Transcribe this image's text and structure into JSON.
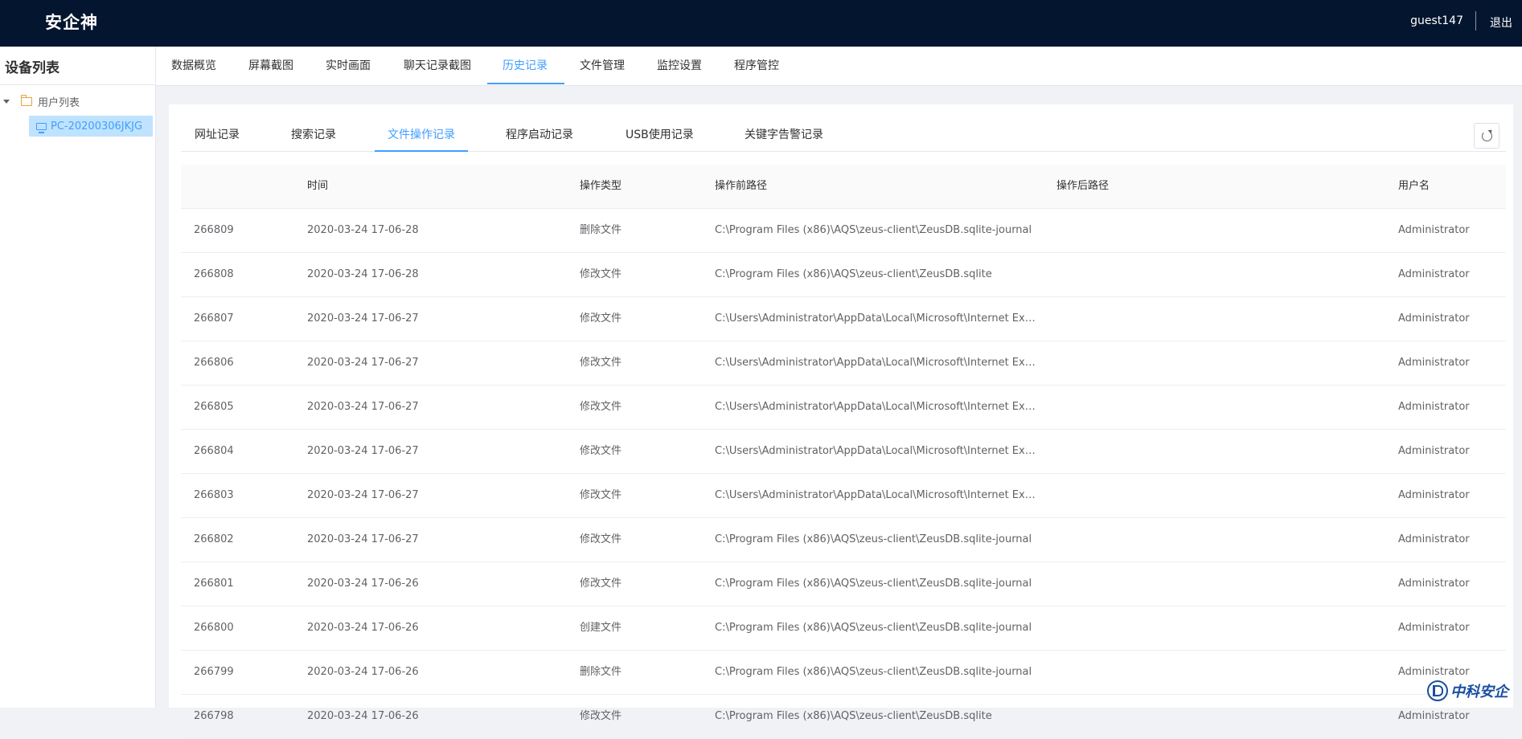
{
  "app": {
    "title": "安企神",
    "username": "guest147",
    "logout_label": "退出"
  },
  "sidebar": {
    "title": "设备列表",
    "tree": {
      "root_label": "用户列表",
      "selected_device": "PC-20200306JKJG"
    }
  },
  "nav": {
    "items": [
      "数据概览",
      "屏幕截图",
      "实时画面",
      "聊天记录截图",
      "历史记录",
      "文件管理",
      "监控设置",
      "程序管控"
    ],
    "active": "历史记录"
  },
  "subtabs": {
    "items": [
      "网址记录",
      "搜索记录",
      "文件操作记录",
      "程序启动记录",
      "USB使用记录",
      "关键字告警记录"
    ],
    "active": "文件操作记录"
  },
  "table": {
    "headers": [
      "",
      "时间",
      "操作类型",
      "操作前路径",
      "操作后路径",
      "用户名"
    ],
    "rows": [
      [
        "266809",
        "2020-03-24 17-06-28",
        "删除文件",
        "C:\\Program Files (x86)\\AQS\\zeus-client\\ZeusDB.sqlite-journal",
        "",
        "Administrator"
      ],
      [
        "266808",
        "2020-03-24 17-06-28",
        "修改文件",
        "C:\\Program Files (x86)\\AQS\\zeus-client\\ZeusDB.sqlite",
        "",
        "Administrator"
      ],
      [
        "266807",
        "2020-03-24 17-06-27",
        "修改文件",
        "C:\\Users\\Administrator\\AppData\\Local\\Microsoft\\Internet Exp...",
        "",
        "Administrator"
      ],
      [
        "266806",
        "2020-03-24 17-06-27",
        "修改文件",
        "C:\\Users\\Administrator\\AppData\\Local\\Microsoft\\Internet Exp...",
        "",
        "Administrator"
      ],
      [
        "266805",
        "2020-03-24 17-06-27",
        "修改文件",
        "C:\\Users\\Administrator\\AppData\\Local\\Microsoft\\Internet Exp...",
        "",
        "Administrator"
      ],
      [
        "266804",
        "2020-03-24 17-06-27",
        "修改文件",
        "C:\\Users\\Administrator\\AppData\\Local\\Microsoft\\Internet Exp...",
        "",
        "Administrator"
      ],
      [
        "266803",
        "2020-03-24 17-06-27",
        "修改文件",
        "C:\\Users\\Administrator\\AppData\\Local\\Microsoft\\Internet Exp...",
        "",
        "Administrator"
      ],
      [
        "266802",
        "2020-03-24 17-06-27",
        "修改文件",
        "C:\\Program Files (x86)\\AQS\\zeus-client\\ZeusDB.sqlite-journal",
        "",
        "Administrator"
      ],
      [
        "266801",
        "2020-03-24 17-06-26",
        "修改文件",
        "C:\\Program Files (x86)\\AQS\\zeus-client\\ZeusDB.sqlite-journal",
        "",
        "Administrator"
      ],
      [
        "266800",
        "2020-03-24 17-06-26",
        "创建文件",
        "C:\\Program Files (x86)\\AQS\\zeus-client\\ZeusDB.sqlite-journal",
        "",
        "Administrator"
      ],
      [
        "266799",
        "2020-03-24 17-06-26",
        "删除文件",
        "C:\\Program Files (x86)\\AQS\\zeus-client\\ZeusDB.sqlite-journal",
        "",
        "Administrator"
      ],
      [
        "266798",
        "2020-03-24 17-06-26",
        "修改文件",
        "C:\\Program Files (x86)\\AQS\\zeus-client\\ZeusDB.sqlite",
        "",
        "Administrator"
      ]
    ]
  },
  "watermark": {
    "text": "中科安企"
  },
  "colors": {
    "topbar": "#03152f",
    "accent": "#409eff",
    "selected_bg": "#bfe3ff",
    "folder": "#e6a23c"
  },
  "icons": [
    "caret-down-icon",
    "folder-icon",
    "monitor-icon",
    "refresh-icon",
    "logo-mark-icon"
  ]
}
